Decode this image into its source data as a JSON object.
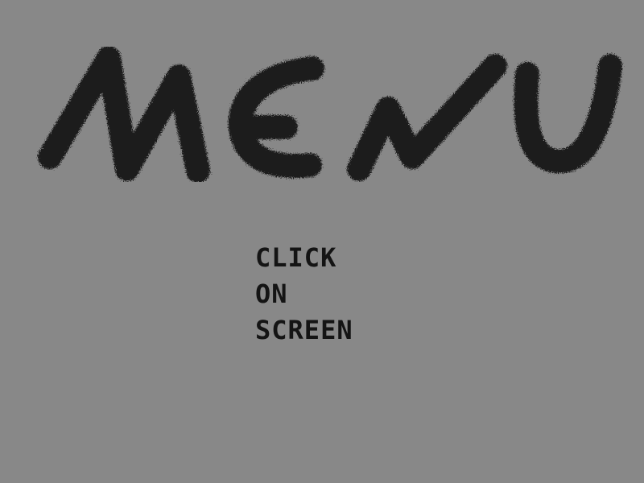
{
  "screen": {
    "background_color": "#888888"
  },
  "title": {
    "text": "MENU",
    "ink_color": "#1e1e1e"
  },
  "prompt": {
    "lines": [
      "CLICK",
      "ON",
      "SCREEN"
    ],
    "text_color": "#141414"
  }
}
